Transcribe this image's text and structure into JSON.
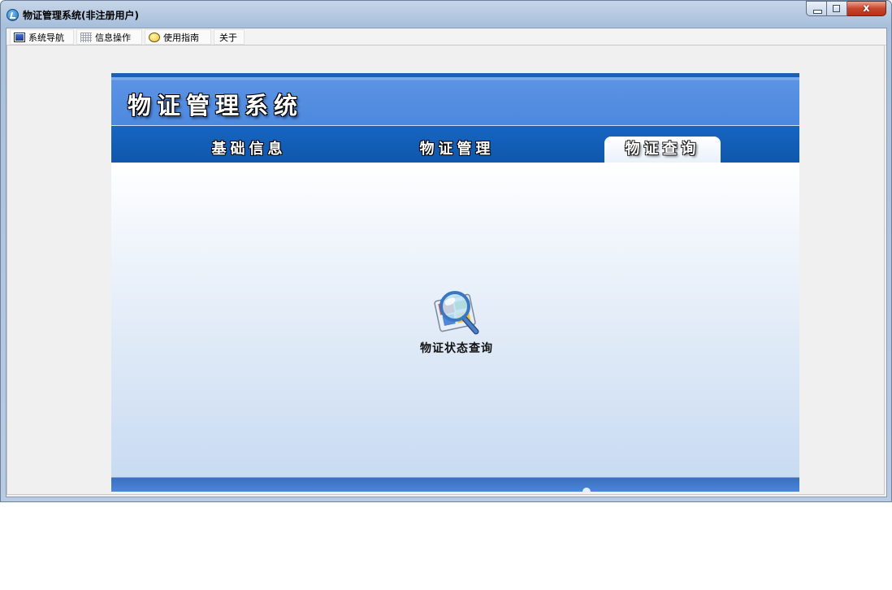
{
  "window": {
    "title": "物证管理系统(非注册用户)",
    "icon": "app-logo-icon",
    "controls": {
      "minimize_icon": "minimize-icon",
      "maximize_icon": "maximize-icon",
      "close_glyph": "x"
    }
  },
  "menubar": {
    "items": [
      {
        "label": "系统导航",
        "icon": "monitor-icon"
      },
      {
        "label": "信息操作",
        "icon": "grid-icon"
      },
      {
        "label": "使用指南",
        "icon": "help-circle-icon"
      },
      {
        "label": "关于",
        "icon": ""
      }
    ]
  },
  "banner": {
    "system_title": "物证管理系统",
    "tabs": [
      {
        "label": "基础信息",
        "active": false
      },
      {
        "label": "物证管理",
        "active": false
      },
      {
        "label": "物证查询",
        "active": true
      }
    ]
  },
  "content": {
    "features": [
      {
        "label": "物证状态查询",
        "icon": "magnifier-search-icon"
      }
    ]
  },
  "colors": {
    "header_blue": "#4d89de",
    "tabbar_blue": "#1665c1",
    "content_gradient_end": "#c8dbf2",
    "close_button_red": "#c7462b"
  }
}
